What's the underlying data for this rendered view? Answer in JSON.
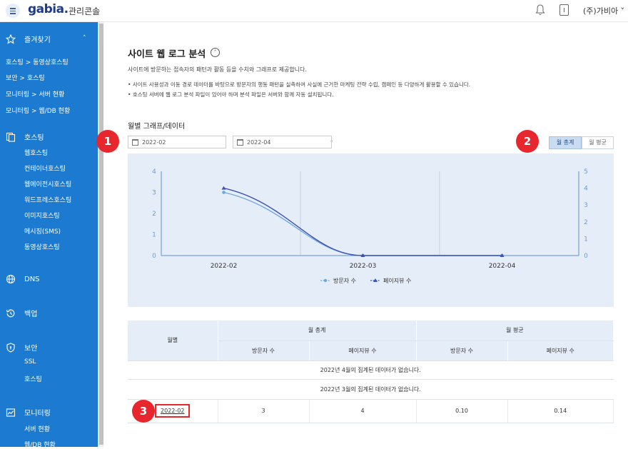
{
  "header": {
    "logo": "gabia.",
    "console_title": "관리콘솔",
    "user": "(주)가비아"
  },
  "sidebar": {
    "favorites_label": "즐겨찾기",
    "favorites": [
      "호스팅 > 동영상호스팅",
      "보안 > 호스팅",
      "모니터링 > 서버 현황",
      "모니터링 > 웹/DB 현황"
    ],
    "hosting_label": "호스팅",
    "hosting_items": [
      "웹호스팅",
      "컨테이너호스팅",
      "웹에이전시호스팅",
      "워드프레스호스팅",
      "이미지호스팅",
      "메시징(SMS)",
      "동영상호스팅"
    ],
    "dns_label": "DNS",
    "backup_label": "백업",
    "security_label": "보안",
    "security_items": [
      "SSL",
      "호스팅"
    ],
    "monitoring_label": "모니터링",
    "monitoring_items": [
      "서버 현황",
      "웹/DB 현황"
    ]
  },
  "page": {
    "title": "사이트 웹 로그 분석",
    "description": "사이트에 방문하는 접속자의 패턴과 활동 등을 수치와 그래프로 제공합니다.",
    "bullets": [
      "사이트 사용성과 이동 경로 데이터를 바탕으로 방문자의 행동 패턴을 실측하여 사실에 근거한 마케팅 전략 수립, 캠페인 등 다양하게 활용할 수 있습니다.",
      "호스팅 서버에 웹 로그 분석 파일이 있어야 하며 분석 파일은 서버와 함께 자동 설치됩니다."
    ],
    "section_title": "월별 그래프/데이터",
    "date_from": "2022-02",
    "date_to": "2022-04",
    "toggle_total": "월 총계",
    "toggle_avg": "월 평균",
    "badges": [
      "1",
      "2",
      "3"
    ]
  },
  "chart_data": {
    "type": "line",
    "categories": [
      "2022-02",
      "2022-03",
      "2022-04"
    ],
    "series": [
      {
        "name": "방문자 수",
        "values": [
          3,
          0,
          0
        ],
        "axis": "left",
        "color": "#6fa8dc",
        "marker": "circle"
      },
      {
        "name": "페이지뷰 수",
        "values": [
          4,
          0,
          0
        ],
        "axis": "right",
        "color": "#3f51b5",
        "marker": "triangle"
      }
    ],
    "y_left_ticks": [
      "0",
      "1",
      "2",
      "3",
      "4"
    ],
    "y_right_ticks": [
      "0",
      "1",
      "2",
      "3",
      "4",
      "5"
    ],
    "ylim_left": [
      0,
      4
    ],
    "ylim_right": [
      0,
      5
    ],
    "legend_position": "bottom"
  },
  "table": {
    "col_month": "월별",
    "group_total": "월 총계",
    "group_avg": "월 평균",
    "sub_headers": [
      "방문자 수",
      "페이지뷰 수",
      "방문자 수",
      "페이지뷰 수"
    ],
    "empty_rows": [
      "2022년 4월의 집계된 데이터가 없습니다.",
      "2022년 3월의 집계된 데이터가 없습니다."
    ],
    "data_row": {
      "month": "2022-02",
      "total_visitors": "3",
      "total_pageviews": "4",
      "avg_visitors": "0.10",
      "avg_pageviews": "0.14"
    }
  }
}
